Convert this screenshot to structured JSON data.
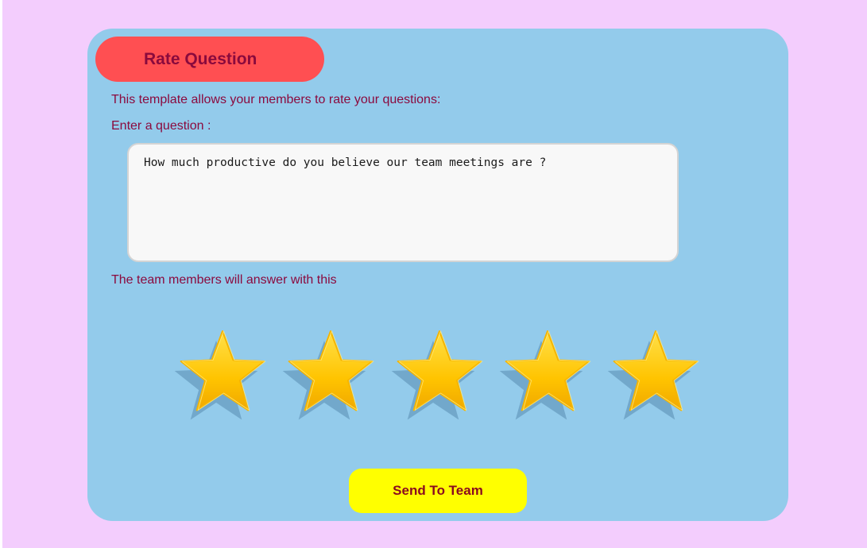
{
  "header": {
    "title": "Rate Question"
  },
  "intro": {
    "description": "This template allows your members to rate your questions:",
    "question_prompt": "Enter a question :"
  },
  "question": {
    "value": "How much productive do you believe our team meetings are ?"
  },
  "answer": {
    "label": "The team members will answer with this",
    "rating_scale": 5,
    "star_icon": "star-icon"
  },
  "actions": {
    "send_label": "Send To Team"
  },
  "colors": {
    "page_background": "#f3cdfd",
    "card_background": "#93cbeb",
    "header_pill": "#ff4f52",
    "text": "#8b0a3e",
    "send_button": "#ffff00",
    "star_fill": "#ffc400"
  }
}
